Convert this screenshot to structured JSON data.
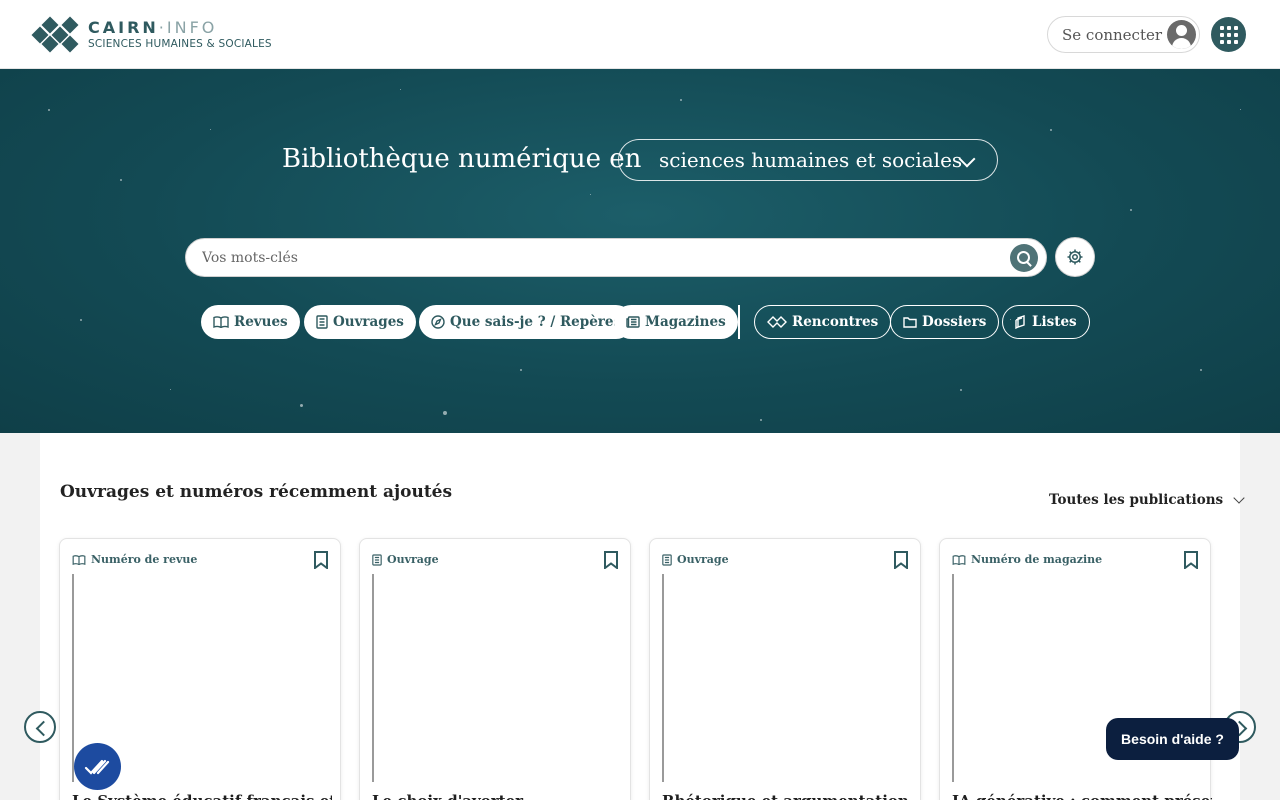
{
  "header": {
    "logo_title": "CAIRN",
    "logo_title_suffix": "·INFO",
    "logo_subtitle": "SCIENCES HUMAINES & SOCIALES",
    "login_label": "Se connecter"
  },
  "hero": {
    "title": "Bibliothèque numérique en",
    "discipline_selected": "sciences humaines et sociales",
    "search_placeholder": "Vos mots-clés",
    "chips": [
      {
        "label": "Revues",
        "icon": "open-book-icon"
      },
      {
        "label": "Ouvrages",
        "icon": "book-icon"
      },
      {
        "label": "Que sais-je ? / Repères",
        "icon": "compass-icon"
      },
      {
        "label": "Magazines",
        "icon": "newspaper-icon"
      },
      {
        "label": "Rencontres",
        "icon": "handshake-icon"
      },
      {
        "label": "Dossiers",
        "icon": "folder-icon"
      },
      {
        "label": "Listes",
        "icon": "stack-icon"
      }
    ]
  },
  "recent": {
    "title": "Ouvrages et numéros récemment ajoutés",
    "filter_label": "Toutes les publications",
    "cards": [
      {
        "type": "Numéro de revue",
        "title": "Le Système éducatif français et son"
      },
      {
        "type": "Ouvrage",
        "title": "Le choix d'avorter"
      },
      {
        "type": "Ouvrage",
        "title": "Rhétorique et argumentation"
      },
      {
        "type": "Numéro de magazine",
        "title": "IA générative : comment préserver"
      }
    ]
  },
  "help_label": "Besoin d'aide ?",
  "colors": {
    "brand": "#2f5a5f",
    "hero_bg": "#134a54",
    "help_bg": "#0c1f3f",
    "a11y_bg": "#1d4ba0"
  }
}
